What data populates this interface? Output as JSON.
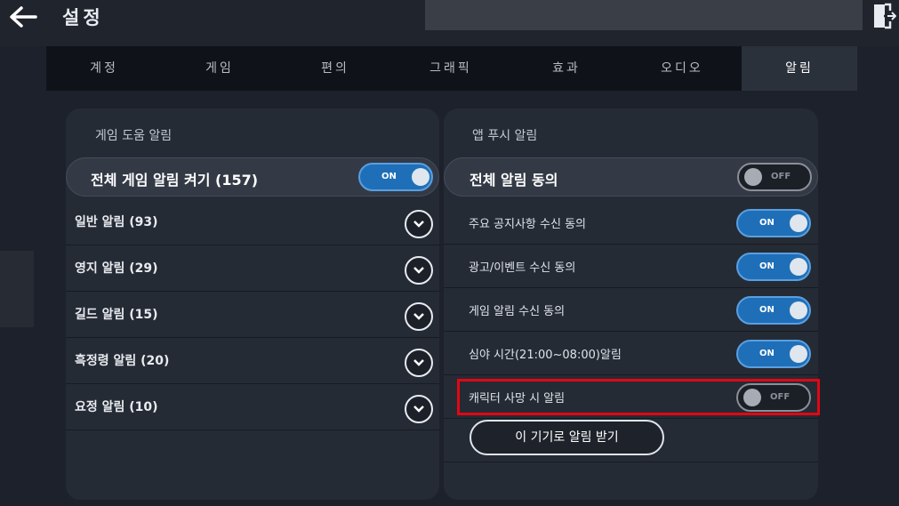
{
  "header": {
    "title": "설정",
    "back_icon": "arrow-left-icon",
    "exit_icon": "exit-door-icon"
  },
  "tabs": [
    {
      "label": "계정",
      "active": false
    },
    {
      "label": "게임",
      "active": false
    },
    {
      "label": "편의",
      "active": false
    },
    {
      "label": "그래픽",
      "active": false
    },
    {
      "label": "효과",
      "active": false
    },
    {
      "label": "오디오",
      "active": false
    },
    {
      "label": "알림",
      "active": true
    }
  ],
  "left_panel": {
    "header": "게임 도움 알림",
    "master": {
      "label": "전체 게임 알림 켜기 (157)",
      "toggle": "ON"
    },
    "items": [
      {
        "label": "일반 알림 (93)"
      },
      {
        "label": "영지 알림 (29)"
      },
      {
        "label": "길드 알림 (15)"
      },
      {
        "label": "흑정령 알림 (20)"
      },
      {
        "label": "요정 알림 (10)"
      }
    ]
  },
  "right_panel": {
    "header": "앱 푸시 알림",
    "master": {
      "label": "전체 알림 동의",
      "toggle": "OFF"
    },
    "items": [
      {
        "label": "주요 공지사항 수신 동의",
        "toggle": "ON"
      },
      {
        "label": "광고/이벤트 수신 동의",
        "toggle": "ON"
      },
      {
        "label": "게임 알림 수신 동의",
        "toggle": "ON"
      },
      {
        "label": "심야 시간(21:00~08:00)알림",
        "toggle": "ON"
      },
      {
        "label": "캐릭터 사망 시 알림",
        "toggle": "OFF"
      }
    ],
    "device_button": "이 기기로 알림 받기"
  },
  "colors": {
    "toggle_on": "#1f6fb8",
    "highlight": "#e30613",
    "background": "#1c212b"
  }
}
